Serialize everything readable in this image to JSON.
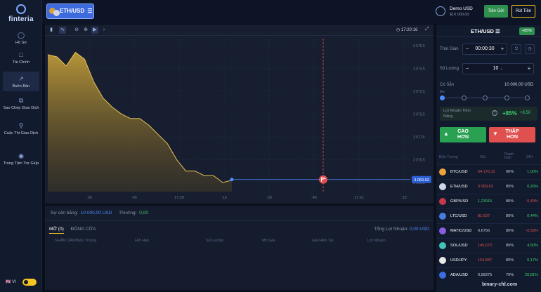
{
  "sidebar": {
    "logo": "finteria",
    "items": [
      {
        "label": "Hồ Sơ",
        "icon": "profile-icon"
      },
      {
        "label": "Tài Chính",
        "icon": "finance-icon"
      },
      {
        "label": "Buôn Bán",
        "icon": "trade-icon"
      },
      {
        "label": "Sao Chép Giao Dịch",
        "icon": "copy-trade-icon"
      },
      {
        "label": "Cuộc Thi Giao Dịch",
        "icon": "trophy-icon"
      },
      {
        "label": "Trung Tâm Trợ Giúp",
        "icon": "help-icon"
      }
    ],
    "language": "VI"
  },
  "topbar": {
    "pair": "ETH/USD",
    "account_name": "Demo USD",
    "account_balance": "$10 000,00",
    "deposit": "Tiền Gửi",
    "withdraw": "Rút Tiền"
  },
  "chart": {
    "time": "17:20:16",
    "price_tag": "3 069.63",
    "price_ticks": [
      "3 075.5",
      "3 074.5",
      "3 073.5",
      "3 072.5",
      "3 071.5",
      "3 070.5",
      "3 069.5"
    ],
    "time_ticks": [
      ":30",
      ":45",
      "17:20",
      ":15",
      ":30",
      ":45",
      "17:21",
      ":15"
    ]
  },
  "positions": {
    "balance_label": "Sự cân bằng:",
    "balance_value": "10 000,00 USD",
    "bonus_label": "Thưởng:",
    "bonus_value": "0,00",
    "tab_open": "MỞ (0)",
    "tab_closed": "ĐÓNG CỬA",
    "pnl_label": "Tổng Lợi Nhuận:",
    "pnl_value": "0,00 USD",
    "columns": [
      "NHÃN DÁN/Biểu Tượng",
      "Hết Hạn",
      "Số Lượng",
      "Mở Giá",
      "Giá Hiện Tại",
      "Lợi Nhuận"
    ]
  },
  "order": {
    "pair": "ETH/USD",
    "payout_badge": "+85%",
    "time_label": "Thời Gian",
    "time_value": "00:00:30",
    "amount_label": "Số Lượng",
    "amount_value": "10",
    "available_label": "Có Sẵn",
    "available_value": "10 000,00 USD",
    "slider_start": "0%",
    "profit_label_1": "Lợi Nhuận Tiềm",
    "profit_label_2": "Năng",
    "profit_pct": "+85%",
    "profit_amount": "+8,50",
    "higher_1": "CAO",
    "higher_2": "HƠN",
    "lower_1": "THẤP",
    "lower_2": "HƠN"
  },
  "assets": {
    "head": [
      "Biểu Tượng",
      "Giá",
      "Thanh Toán",
      "24H"
    ],
    "rows": [
      {
        "name": "BTC/USD",
        "price": "64 170,11",
        "payout": "90%",
        "change": "1,00%",
        "price_color": "#e0504f",
        "change_color": "#3bd16f",
        "icon_color": "#f0a33a"
      },
      {
        "name": "ETH/USD",
        "price": "3 069,63",
        "payout": "85%",
        "change": "0,26%",
        "price_color": "#e0504f",
        "change_color": "#3bd16f",
        "icon_color": "#cfd6e8"
      },
      {
        "name": "GBP/USD",
        "price": "1,23915",
        "payout": "80%",
        "change": "-0,49%",
        "price_color": "#3bd16f",
        "change_color": "#e0504f",
        "icon_color": "#c8374a"
      },
      {
        "name": "LTC/USD",
        "price": "81,637",
        "payout": "80%",
        "change": "0,44%",
        "price_color": "#e0504f",
        "change_color": "#3bd16f",
        "icon_color": "#4a7be0"
      },
      {
        "name": "MATIC/USD",
        "price": "0,6756",
        "payout": "80%",
        "change": "-0,59%",
        "price_color": "#c8cfdf",
        "change_color": "#e0504f",
        "icon_color": "#8a5ce0"
      },
      {
        "name": "SOL/USD",
        "price": "145,672",
        "payout": "80%",
        "change": "4,50%",
        "price_color": "#e0504f",
        "change_color": "#3bd16f",
        "icon_color": "#45c2b8"
      },
      {
        "name": "USD/JPY",
        "price": "154,587",
        "payout": "80%",
        "change": "0,17%",
        "price_color": "#e0504f",
        "change_color": "#3bd16f",
        "icon_color": "#e8e8e8"
      },
      {
        "name": "ADA/USD",
        "price": "0,58375",
        "payout": "70%",
        "change": "20,81%",
        "price_color": "#c8cfdf",
        "change_color": "#3bd16f",
        "icon_color": "#3a6fe0"
      }
    ]
  },
  "chart_data": {
    "type": "area",
    "x_ticks": [
      ":30",
      ":45",
      "17:20",
      ":15",
      ":30",
      ":45",
      "17:21",
      ":15"
    ],
    "y_ticks": [
      3075.5,
      3074.5,
      3073.5,
      3072.5,
      3071.5,
      3070.5,
      3069.5
    ],
    "ylim": [
      3069.1,
      3075.8
    ],
    "series": [
      {
        "values": [
          3075.1,
          3075.0,
          3074.6,
          3075.2,
          3074.9,
          3073.9,
          3073.2,
          3072.8,
          3072.5,
          3072.3,
          3072.3,
          3072.0,
          3071.6,
          3071.2,
          3070.5,
          3070.0,
          3070.0,
          3069.8,
          3069.8,
          3069.5,
          3069.6
        ]
      }
    ],
    "current_price": 3069.63,
    "current_price_label": "3 069.63"
  },
  "watermark": "binary-cfd.com",
  "colors": {
    "accent": "#3d6bde",
    "green": "#29a052",
    "red": "#e0504f",
    "gold": "#f3c623"
  }
}
